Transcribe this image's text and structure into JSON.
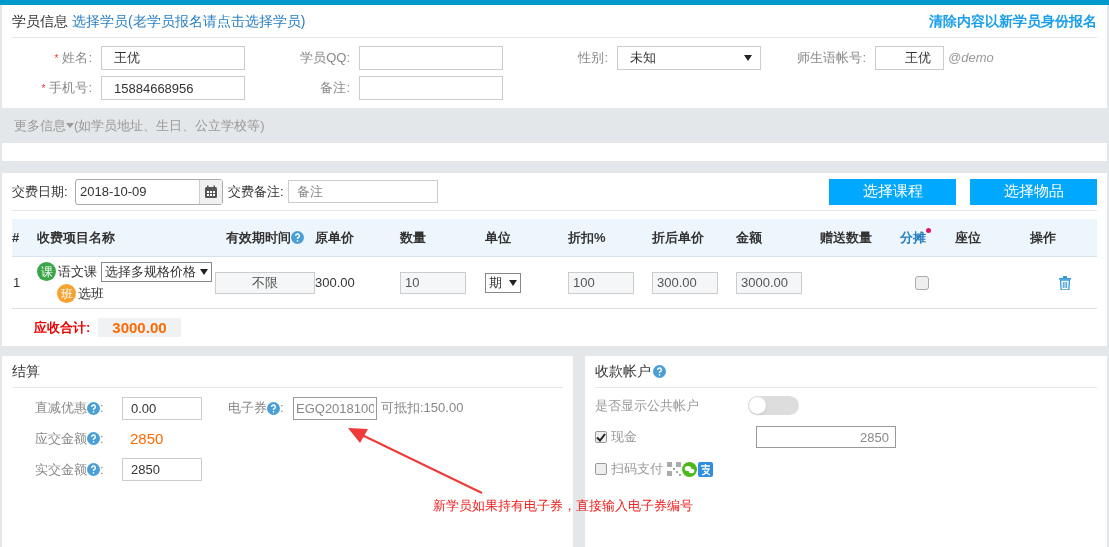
{
  "student_info": {
    "title": "学员信息",
    "select_link": "选择学员(老学员报名请点击选择学员)",
    "clear_link": "清除内容以新学员身份报名",
    "fields": [
      {
        "label": "姓名:",
        "required": true,
        "kind": "input",
        "value": "王优"
      },
      {
        "label": "学员QQ:",
        "required": false,
        "kind": "input"
      },
      {
        "label": "性别:",
        "required": false,
        "kind": "select",
        "value": "未知"
      },
      {
        "label": "师生语帐号:",
        "required": false,
        "kind": "account",
        "value": "王优",
        "suffix": "@demo"
      },
      {
        "label": "手机号:",
        "required": true,
        "kind": "input",
        "value": "15884668956"
      },
      {
        "label": "备注:",
        "required": false,
        "kind": "input"
      }
    ],
    "required_mark": "*",
    "more_info": "更多信息",
    "more_hint": "(如学员地址、生日、公立学校等)"
  },
  "payment": {
    "date_label": "交费日期:",
    "date": "2018-10-09",
    "note_label": "交费备注:",
    "note_placeholder": "备注",
    "buttons": [
      "选择课程",
      "选择物品"
    ],
    "table": {
      "columns": [
        {
          "label": "#",
          "kind": "plain"
        },
        {
          "label": "收费项目名称",
          "kind": "plain"
        },
        {
          "label": "有效期时间",
          "kind": "help"
        },
        {
          "label": "原单价",
          "kind": "plain"
        },
        {
          "label": "数量",
          "kind": "plain"
        },
        {
          "label": "单位",
          "kind": "plain"
        },
        {
          "label": "折扣%",
          "kind": "plain"
        },
        {
          "label": "折后单价",
          "kind": "plain"
        },
        {
          "label": "金额",
          "kind": "plain"
        },
        {
          "label": "赠送数量",
          "kind": "plain"
        },
        {
          "label": "分摊",
          "kind": "link"
        },
        {
          "label": "座位",
          "kind": "plain"
        },
        {
          "label": "操作",
          "kind": "plain"
        }
      ],
      "rows": [
        {
          "index": "1",
          "course_badge": "课",
          "course": "语文课",
          "spec_select": "选择多规格价格",
          "class_badge": "班",
          "class_link": "选班",
          "validity": "不限",
          "unit_price": "300.00",
          "quantity": "10",
          "unit": "期",
          "discount": "100",
          "discounted_price": "300.00",
          "amount": "3000.00",
          "split": false
        }
      ]
    },
    "total_label": "应收合计:",
    "total": "3000.00"
  },
  "settlement": {
    "title": "结算",
    "discount_label": "直减优惠",
    "discount_colon": ":",
    "coupon_colon": ":",
    "due_colon": ":",
    "paid_colon": ":",
    "discount": "0.00",
    "coupon_label": "电子券",
    "coupon": "EGQ2018100",
    "coupon_deduct": "可抵扣:150.00",
    "due_label": "应交金额",
    "due": "2850",
    "paid_label": "实交金额",
    "paid": "2850"
  },
  "accounts": {
    "title": "收款帐户",
    "public_label": "是否显示公共帐户",
    "public_on": false,
    "methods": [
      {
        "label": "现金",
        "checked": true,
        "kind": "cash",
        "value": "2850"
      },
      {
        "label": "扫码支付",
        "checked": false,
        "kind": "qr"
      }
    ]
  },
  "annotation": {
    "text": "新学员如果持有电子券，直接输入电子券编号"
  }
}
